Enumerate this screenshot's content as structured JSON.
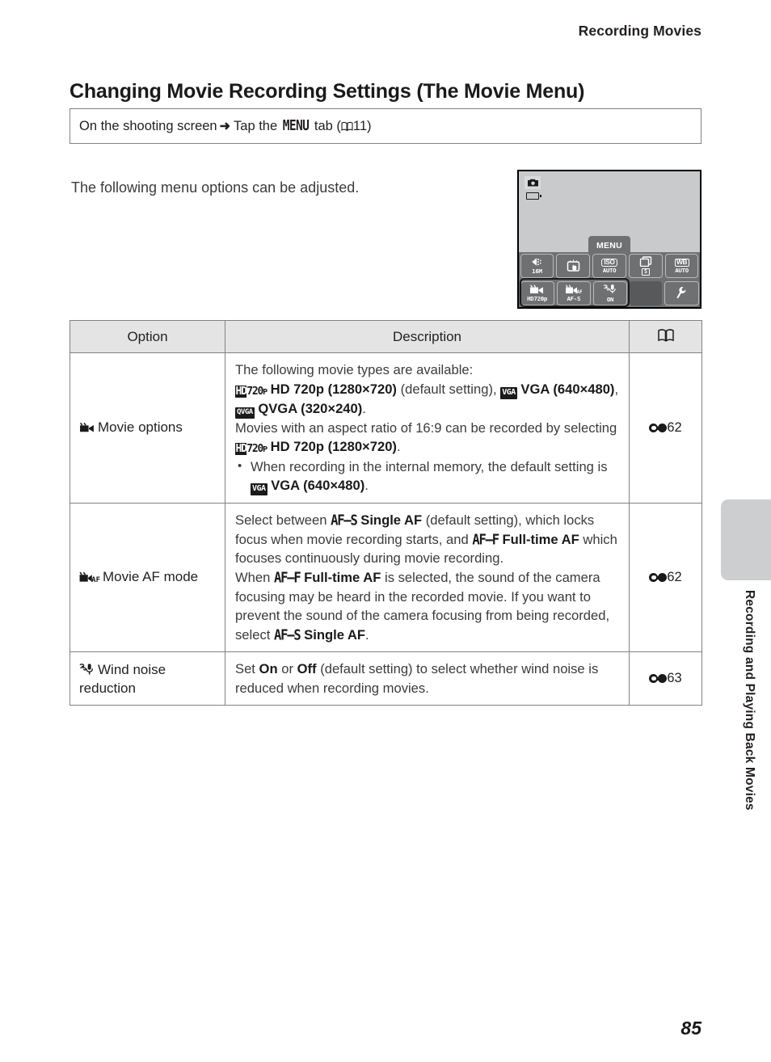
{
  "header": {
    "running_head": "Recording Movies"
  },
  "page_title": "Changing Movie Recording Settings (The Movie Menu)",
  "path_box": {
    "part1": "On the shooting screen",
    "arrow": "➜",
    "part2": "Tap the",
    "menu_label": "MENU",
    "part3": "tab",
    "open_paren": "(",
    "book_icon": "📖",
    "ref_page": "11",
    "close_paren": ")"
  },
  "intro_line": "The following menu options can be adjusted.",
  "camera_screen": {
    "mode_icon": "camera-icon",
    "battery_icon": "battery-icon",
    "menu_tab_label": "MENU",
    "row_top": [
      {
        "name": "image-quality",
        "glyph": "◀⋮",
        "sublabel": "16M"
      },
      {
        "name": "touch-shutter",
        "glyph": "☝",
        "sublabel": ""
      },
      {
        "name": "iso-sensitivity",
        "glyph": "ISO",
        "sublabel": "AUTO"
      },
      {
        "name": "continuous-shooting",
        "glyph": "❐",
        "sublabel": "S"
      },
      {
        "name": "white-balance",
        "glyph": "WB",
        "sublabel": "AUTO"
      }
    ],
    "row_bottom": [
      {
        "name": "movie-options",
        "glyph": "🎥",
        "sublabel": "HD720p"
      },
      {
        "name": "movie-af-mode",
        "glyph": "🎥AF",
        "sublabel": "AF-S"
      },
      {
        "name": "wind-noise-reduction",
        "glyph": "🌬",
        "sublabel": "ON"
      },
      {
        "name": "blank-cell",
        "glyph": "",
        "sublabel": ""
      },
      {
        "name": "setup-menu",
        "glyph": "🔧",
        "sublabel": ""
      }
    ]
  },
  "table": {
    "headers": {
      "option": "Option",
      "description": "Description",
      "reference_icon": "open-book-icon"
    },
    "rows": [
      {
        "option_icon": "movie-camera-icon",
        "option_label": "Movie options",
        "reference": "62",
        "description": {
          "line1": "The following movie types are available:",
          "chip_hd": "HD720P",
          "bold_hd": "HD 720p (1280×720)",
          "note_default": "(default setting),",
          "chip_vga": "VGA",
          "bold_vga": "VGA (640×480)",
          "comma": ",",
          "chip_qvga": "QVGA",
          "bold_qvga": "QVGA (320×240)",
          "period": ".",
          "line2a": "Movies with an aspect ratio of 16:9 can be recorded by selecting",
          "line2b": "HD 720p (1280×720)",
          "bullet1a": "When recording in the internal memory, the default setting is",
          "bullet1b": "VGA (640×480)"
        }
      },
      {
        "option_icon": "movie-af-icon",
        "option_label": "Movie AF mode",
        "reference": "62",
        "description": {
          "p1a": "Select between",
          "afs": "AF–S",
          "p1b": "Single AF",
          "p1c": "(default setting), which locks focus when movie recording starts, and",
          "aff": "AF–F",
          "p1d": "Full-time AF",
          "p1e": "which focuses continuously during movie recording.",
          "p2a": "When",
          "p2b": "Full-time AF",
          "p2c": "is selected, the sound of the camera focusing may be heard in the recorded movie. If you want to prevent the sound of the camera focusing from being recorded, select",
          "p2d": "Single AF",
          "p2e": "."
        }
      },
      {
        "option_icon": "wind-noise-icon",
        "option_label_line1": "Wind noise",
        "option_label_line2": "reduction",
        "reference": "63",
        "description": {
          "a": "Set",
          "on": "On",
          "b": "or",
          "off": "Off",
          "c": "(default setting) to select whether wind noise is reduced when recording movies."
        }
      }
    ]
  },
  "side_tab": {
    "vertical_title": "Recording and Playing Back Movies"
  },
  "footer": {
    "page_number": "85"
  },
  "colors": {
    "rule": "#808285",
    "header_fill": "#e4e4e5",
    "tab_fill": "#cdced0",
    "screen_fill": "#c9cacb",
    "screen_bar": "#6e7072"
  }
}
